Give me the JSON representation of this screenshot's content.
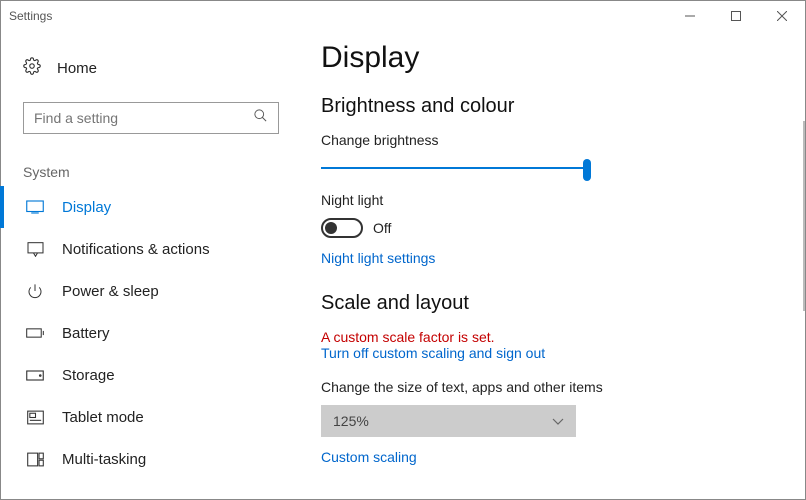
{
  "window": {
    "title": "Settings"
  },
  "home": {
    "label": "Home"
  },
  "search": {
    "placeholder": "Find a setting"
  },
  "system_label": "System",
  "nav": {
    "display": "Display",
    "notifications": "Notifications & actions",
    "power": "Power & sleep",
    "battery": "Battery",
    "storage": "Storage",
    "tablet": "Tablet mode",
    "multitask": "Multi-tasking"
  },
  "main": {
    "title": "Display",
    "brightness_section": "Brightness and colour",
    "brightness_label": "Change brightness",
    "nightlight_label": "Night light",
    "nightlight_state": "Off",
    "nightlight_link": "Night light settings",
    "scale_section": "Scale and layout",
    "scale_warning": "A custom scale factor is set.",
    "scale_warning_link": "Turn off custom scaling and sign out",
    "scale_label": "Change the size of text, apps and other items",
    "scale_value": "125%",
    "custom_scaling_link": "Custom scaling"
  }
}
